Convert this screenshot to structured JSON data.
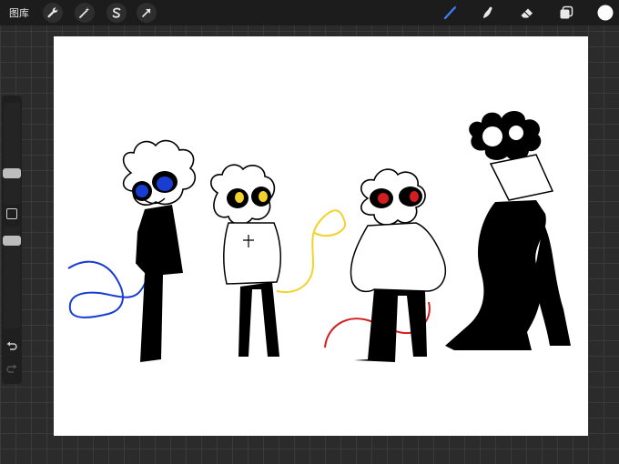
{
  "toolbar": {
    "gallery_label": "图库",
    "left_tools": [
      {
        "name": "actions",
        "icon": "wrench-icon"
      },
      {
        "name": "adjustments",
        "icon": "magic-wand-icon"
      },
      {
        "name": "selection",
        "icon": "selection-s-icon"
      },
      {
        "name": "transform",
        "icon": "arrow-cursor-icon"
      }
    ],
    "right_tools": [
      {
        "name": "brush",
        "icon": "brush-icon",
        "active": true
      },
      {
        "name": "smudge",
        "icon": "smudge-finger-icon"
      },
      {
        "name": "eraser",
        "icon": "eraser-icon"
      },
      {
        "name": "layers",
        "icon": "layers-icon"
      },
      {
        "name": "color",
        "icon": "color-swatch-icon"
      }
    ]
  },
  "sidebar": {
    "brush_size_slider": {
      "level": 0.45
    },
    "opacity_slider": {
      "level": 0.55
    },
    "modify_button_icon": "square-icon",
    "undo_icon": "undo-arrow-icon",
    "redo_icon": "redo-arrow-icon"
  },
  "canvas": {
    "artwork": "four-stylized-characters-drawing"
  },
  "colors": {
    "active_tool": "#3d7ff2",
    "current_color": "#ffffff",
    "ink": "#000000",
    "blue_stroke": "#1a3dd1",
    "yellow_stroke": "#f2d22b",
    "red_stroke": "#d21e1e"
  }
}
